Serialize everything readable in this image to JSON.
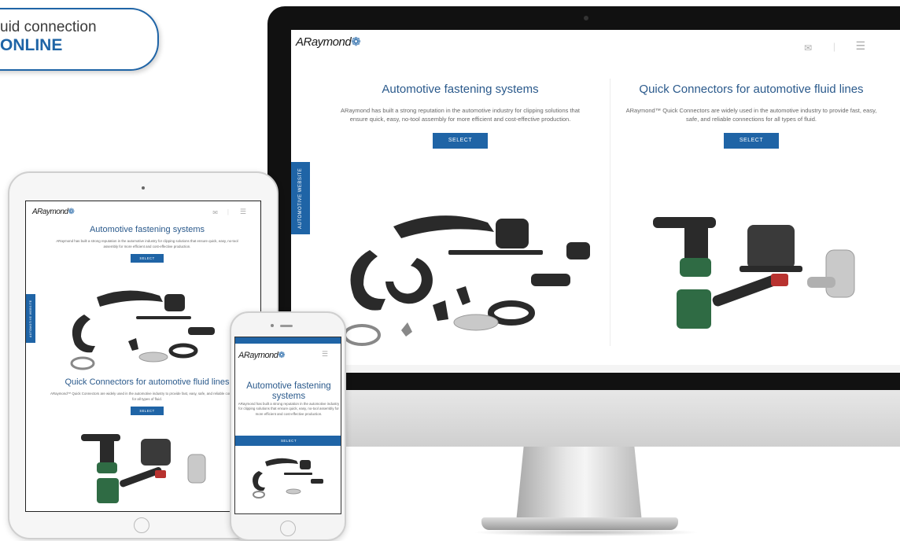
{
  "badge": {
    "line1": "uid connection",
    "line2": "ONLINE"
  },
  "site": {
    "logo": "ARaymond",
    "side_tab": "AUTOMOTIVE WEBSITE",
    "fastening": {
      "title": "Automotive fastening systems",
      "text": "ARaymond has built a strong reputation in the automotive industry for clipping solutions that ensure quick, easy, no-tool assembly for more efficient and cost-effective production.",
      "button": "SELECT"
    },
    "connectors": {
      "title": "Quick Connectors for automotive fluid lines",
      "text": "ARaymond™ Quick Connectors are widely used in the automotive industry to provide fast, easy, safe, and reliable connections for all types of fluid.",
      "button": "SELECT"
    }
  },
  "icons": {
    "mail": "mail-icon",
    "menu": "hamburger-menu-icon",
    "logo_mark": "araymond-logo-icon"
  },
  "colors": {
    "brand_blue": "#1f64a6",
    "title_blue": "#2b5a8c",
    "product_dark": "#2a2a2a",
    "connector_green": "#2f6b44",
    "connector_red": "#b8322f"
  }
}
